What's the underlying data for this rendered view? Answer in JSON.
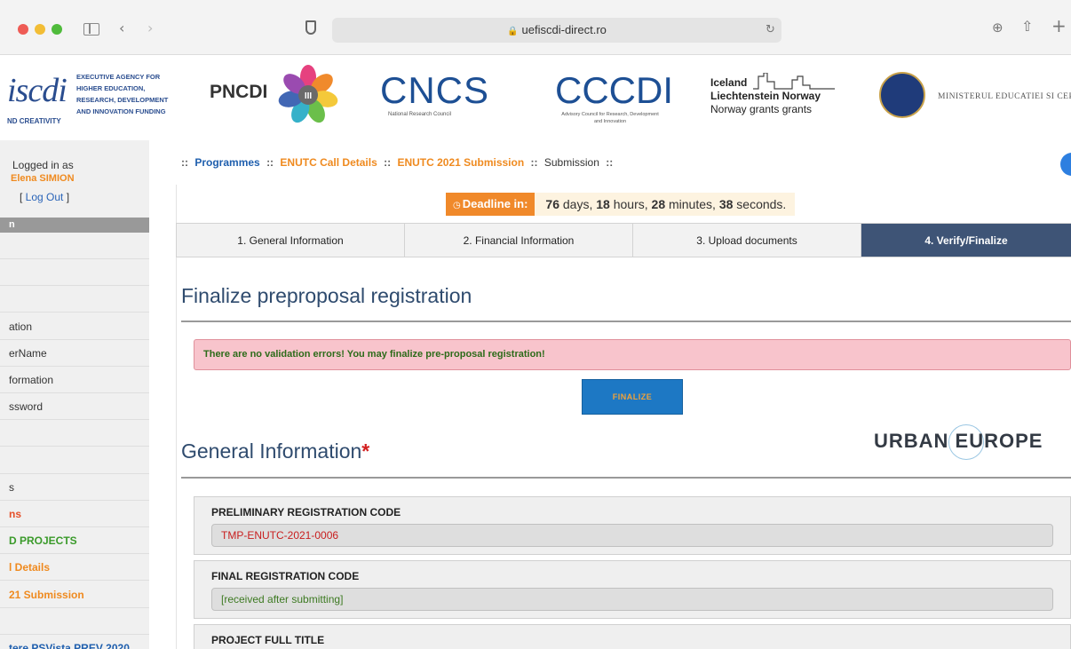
{
  "browser": {
    "url": "uefiscdi-direct.ro"
  },
  "banner": {
    "fiscdi_logo": "iscdi",
    "fiscdi_sub": "ND CREATIVITY",
    "agency_text": [
      "EXECUTIVE AGENCY FOR",
      "HIGHER EDUCATION,",
      "RESEARCH, DEVELOPMENT",
      "AND INNOVATION FUNDING"
    ],
    "pncdi": "PNCDI",
    "pncdi_numeral": "III",
    "cncs": "CNCS",
    "cncs_sub": "National Research Council",
    "cccdi": "CCCDI",
    "cccdi_sub": "Advisory Council for Research, Development and Innovation",
    "eea_lines": [
      "Iceland",
      "Liechtenstein  Norway",
      "Norway grants  grants"
    ],
    "ministry": "MINISTERUL EDUCATIEI SI CER"
  },
  "sidebar": {
    "logged_in_label": "Logged in as",
    "user_name": "Elena SIMION",
    "logout_open": "[ ",
    "logout_label": "Log Out",
    "logout_close": " ]",
    "header": "n",
    "items": [
      {
        "label": "",
        "color": "#333333"
      },
      {
        "label": "",
        "color": "#333333"
      },
      {
        "label": "",
        "color": "#333333"
      },
      {
        "label": "ation",
        "color": "#333333"
      },
      {
        "label": "erName",
        "color": "#333333"
      },
      {
        "label": "formation",
        "color": "#333333"
      },
      {
        "label": "ssword",
        "color": "#333333"
      },
      {
        "label": "",
        "color": "#333333"
      },
      {
        "label": "",
        "color": "#333333"
      },
      {
        "label": "s",
        "color": "#333333"
      },
      {
        "label": "ns",
        "color": "#e5502a"
      },
      {
        "label": "D PROJECTS",
        "color": "#3a9a2a"
      },
      {
        "label": "l Details",
        "color": "#ef8a1f"
      },
      {
        "label": "21 Submission",
        "color": "#ef8a1f"
      },
      {
        "label": "",
        "color": "#333333"
      },
      {
        "label": "tere PSVista PREV 2020",
        "color": "#1f5fae"
      }
    ]
  },
  "breadcrumb": {
    "sep": "::",
    "items": [
      "Programmes",
      "ENUTC Call Details",
      "ENUTC 2021 Submission",
      "Submission"
    ]
  },
  "deadline": {
    "label": "Deadline in:",
    "days": "76",
    "days_unit": " days, ",
    "hours": "18",
    "hours_unit": " hours, ",
    "minutes": "28",
    "minutes_unit": " minutes, ",
    "seconds": "38",
    "seconds_unit": " seconds."
  },
  "tabs": [
    {
      "label": "1. General Information"
    },
    {
      "label": "2. Financial Information"
    },
    {
      "label": "3. Upload documents"
    },
    {
      "label": "4. Verify/Finalize"
    }
  ],
  "finalize_section": {
    "title": "Finalize preproposal registration",
    "message": "There are no validation errors! You may finalize pre-proposal registration!",
    "button": "FINALIZE"
  },
  "general_section": {
    "title": "General Information",
    "required_mark": "*",
    "partner_logo": "URBAN EUROPE",
    "fields": [
      {
        "label": "PRELIMINARY REGISTRATION CODE",
        "value": "TMP-ENUTC-2021-0006"
      },
      {
        "label": "FINAL REGISTRATION CODE",
        "value": "[received after submitting]"
      },
      {
        "label": "PROJECT FULL TITLE",
        "value": ""
      }
    ]
  },
  "colors": {
    "active_tab": "#3e5476",
    "deadline_orange": "#f0892a",
    "alert_bg": "#f8c4cc",
    "button_blue": "#1d78c4"
  }
}
